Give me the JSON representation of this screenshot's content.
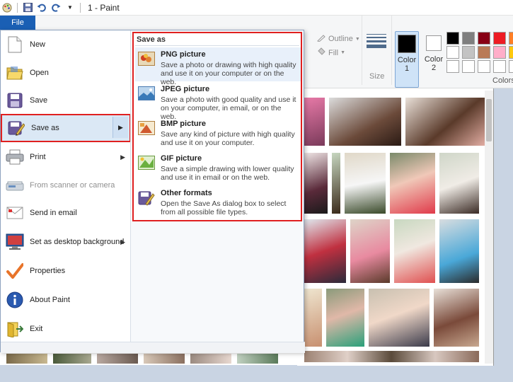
{
  "window": {
    "title": "1 - Paint"
  },
  "file_tab": {
    "label": "File"
  },
  "menu": {
    "items": [
      {
        "label": "New",
        "icon": "new-document-icon"
      },
      {
        "label": "Open",
        "icon": "open-folder-icon"
      },
      {
        "label": "Save",
        "icon": "save-floppy-icon"
      },
      {
        "label": "Save as",
        "icon": "save-as-icon"
      },
      {
        "label": "Print",
        "icon": "printer-icon"
      },
      {
        "label": "From scanner or camera",
        "icon": "scanner-icon"
      },
      {
        "label": "Send in email",
        "icon": "email-icon"
      },
      {
        "label": "Set as desktop background",
        "icon": "desktop-icon"
      },
      {
        "label": "Properties",
        "icon": "checkmark-icon"
      },
      {
        "label": "About Paint",
        "icon": "info-icon"
      },
      {
        "label": "Exit",
        "icon": "exit-icon"
      }
    ]
  },
  "submenu": {
    "title": "Save as",
    "items": [
      {
        "title": "PNG picture",
        "desc": "Save a photo or drawing with high quality and use it on your computer or on the web."
      },
      {
        "title": "JPEG picture",
        "desc": "Save a photo with good quality and use it on your computer, in email, or on the web."
      },
      {
        "title": "BMP picture",
        "desc": "Save any kind of picture with high quality and use it on your computer."
      },
      {
        "title": "GIF picture",
        "desc": "Save a simple drawing with lower quality and use it in email or on the web."
      },
      {
        "title": "Other formats",
        "desc": "Open the Save As dialog box to select from all possible file types."
      }
    ]
  },
  "ribbon": {
    "outline_label": "Outline",
    "fill_label": "Fill",
    "size_label": "Size",
    "color1_label": "Color\n1",
    "color1_line1": "Color",
    "color1_line2": "1",
    "color2_line1": "Color",
    "color2_line2": "2",
    "colors_label": "Colors",
    "color1_value": "#000000",
    "color2_value": "#ffffff",
    "palette": [
      "#000000",
      "#7f7f7f",
      "#880015",
      "#ed1c24",
      "#ff7f27",
      "#ffffff",
      "#c3c3c3",
      "#b97a57",
      "#ffaec9",
      "#ffc90e",
      "#ffffff",
      "#ffffff",
      "#ffffff",
      "#ffffff",
      "#ffffff"
    ]
  }
}
